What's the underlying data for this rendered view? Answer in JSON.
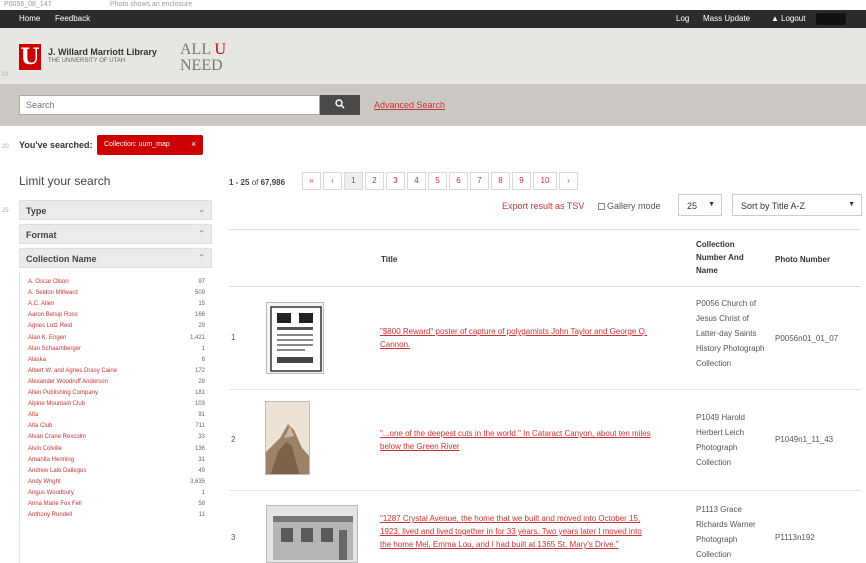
{
  "top_note": {
    "left": "P0056_08_147",
    "right": "Photo shows an enclosure"
  },
  "topbar": {
    "home": "Home",
    "feedback": "Feedback",
    "log": "Log",
    "mass_update": "Mass Update",
    "logout": "Logout"
  },
  "banner": {
    "library_name": "J. Willard Marriott Library",
    "library_sub": "THE UNIVERSITY OF UTAH",
    "logo_letter": "U",
    "tag_all": "ALL",
    "tag_u": "U",
    "tag_need": "NEED"
  },
  "search": {
    "placeholder": "Search",
    "button_icon": "search-icon",
    "advanced": "Advanced Search"
  },
  "side_marks": [
    "01",
    "20",
    "25"
  ],
  "searched": {
    "label": "You've searched:",
    "chip_text": "Collection: uum_map",
    "chip_close": "×"
  },
  "limit_title": "Limit your search",
  "facets": [
    {
      "label": "Type",
      "chev": "⌄"
    },
    {
      "label": "Format",
      "chev": "⌃"
    },
    {
      "label": "Collection Name",
      "chev": "⌃"
    }
  ],
  "facet_items": [
    {
      "name": "A. Oscar Olson",
      "count": "97"
    },
    {
      "name": "A. Seldon Millward",
      "count": "509"
    },
    {
      "name": "A.C. Allen",
      "count": "15"
    },
    {
      "name": "Aaron Betsip Ross",
      "count": "166"
    },
    {
      "name": "Agnes Lutz Reid",
      "count": "29"
    },
    {
      "name": "Alan K. Engen",
      "count": "1,421"
    },
    {
      "name": "Alan Schaamberger",
      "count": "1"
    },
    {
      "name": "Alaska",
      "count": "6"
    },
    {
      "name": "Albert W. and Agnes Drasy Caine",
      "count": "172"
    },
    {
      "name": "Alexander Woodruff Anderson",
      "count": "28"
    },
    {
      "name": "Allen Publishing Company",
      "count": "181"
    },
    {
      "name": "Alpine Mountain Club",
      "count": "103"
    },
    {
      "name": "Alta",
      "count": "91"
    },
    {
      "name": "Alta Club",
      "count": "711"
    },
    {
      "name": "Alvan Crane Rexcolm",
      "count": "33"
    },
    {
      "name": "Alvin Colville",
      "count": "136"
    },
    {
      "name": "Amanita Henning",
      "count": "31"
    },
    {
      "name": "Andrew Lalo Dallegus",
      "count": "49"
    },
    {
      "name": "Andy Wright",
      "count": "3,635"
    },
    {
      "name": "Angus Woodbury",
      "count": "1"
    },
    {
      "name": "Anna Marie Fox Fell",
      "count": "58"
    },
    {
      "name": "Anthony Rundell",
      "count": "11"
    }
  ],
  "results": {
    "range": "1 - 25",
    "of_text": "of",
    "total": "67,986"
  },
  "pager": [
    "«",
    "‹",
    "1",
    "2",
    "3",
    "4",
    "5",
    "6",
    "7",
    "8",
    "9",
    "10",
    "›"
  ],
  "toolbar": {
    "export": "Export result as TSV",
    "gallery": "Gallery mode",
    "per_page": "25",
    "sort": "Sort by Title A-Z"
  },
  "table": {
    "headers": {
      "title": "Title",
      "collection": "Collection Number And Name",
      "photo": "Photo Number"
    },
    "rows": [
      {
        "num": "1",
        "title": "\"$800 Reward\" poster of capture of polygamists John Taylor and George Q. Cannon.",
        "collection": "P0056 Church of Jesus Christ of Latter-day Saints History Photograph Collection",
        "photo": "P0056n01_01_07"
      },
      {
        "num": "2",
        "title": "\"...one of the deepest cuts in the world.\" In Cataract Canyon, about ten miles below the Green River",
        "collection": "P1049 Harold Herbert Leich Photograph Collection",
        "photo": "P1049n1_11_43"
      },
      {
        "num": "3",
        "title": "\"1287 Crystal Avenue, the home that we built and moved into October 15, 1923, lived and lived together in for 33 years. Two years later I moved into the home Mel, Emma Lou, and I had built at 1365 St. Mary's Drive.\"",
        "collection": "P1113 Grace Richards Warner Photograph Collection",
        "photo": "P1113n192"
      }
    ]
  }
}
